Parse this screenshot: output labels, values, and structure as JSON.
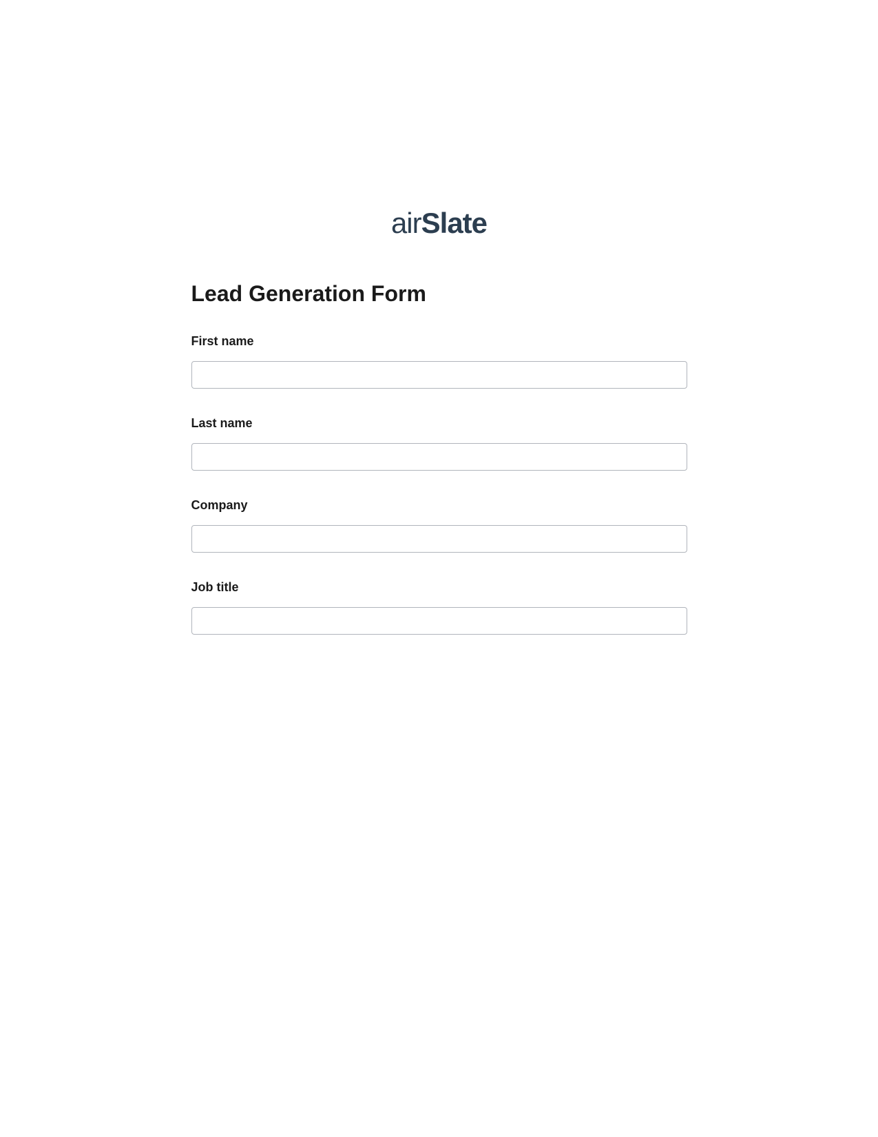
{
  "logo": {
    "part1": "air",
    "part2": "Slate"
  },
  "form": {
    "title": "Lead Generation Form",
    "fields": [
      {
        "label": "First name",
        "value": ""
      },
      {
        "label": "Last name",
        "value": ""
      },
      {
        "label": "Company",
        "value": ""
      },
      {
        "label": "Job title",
        "value": ""
      }
    ]
  }
}
